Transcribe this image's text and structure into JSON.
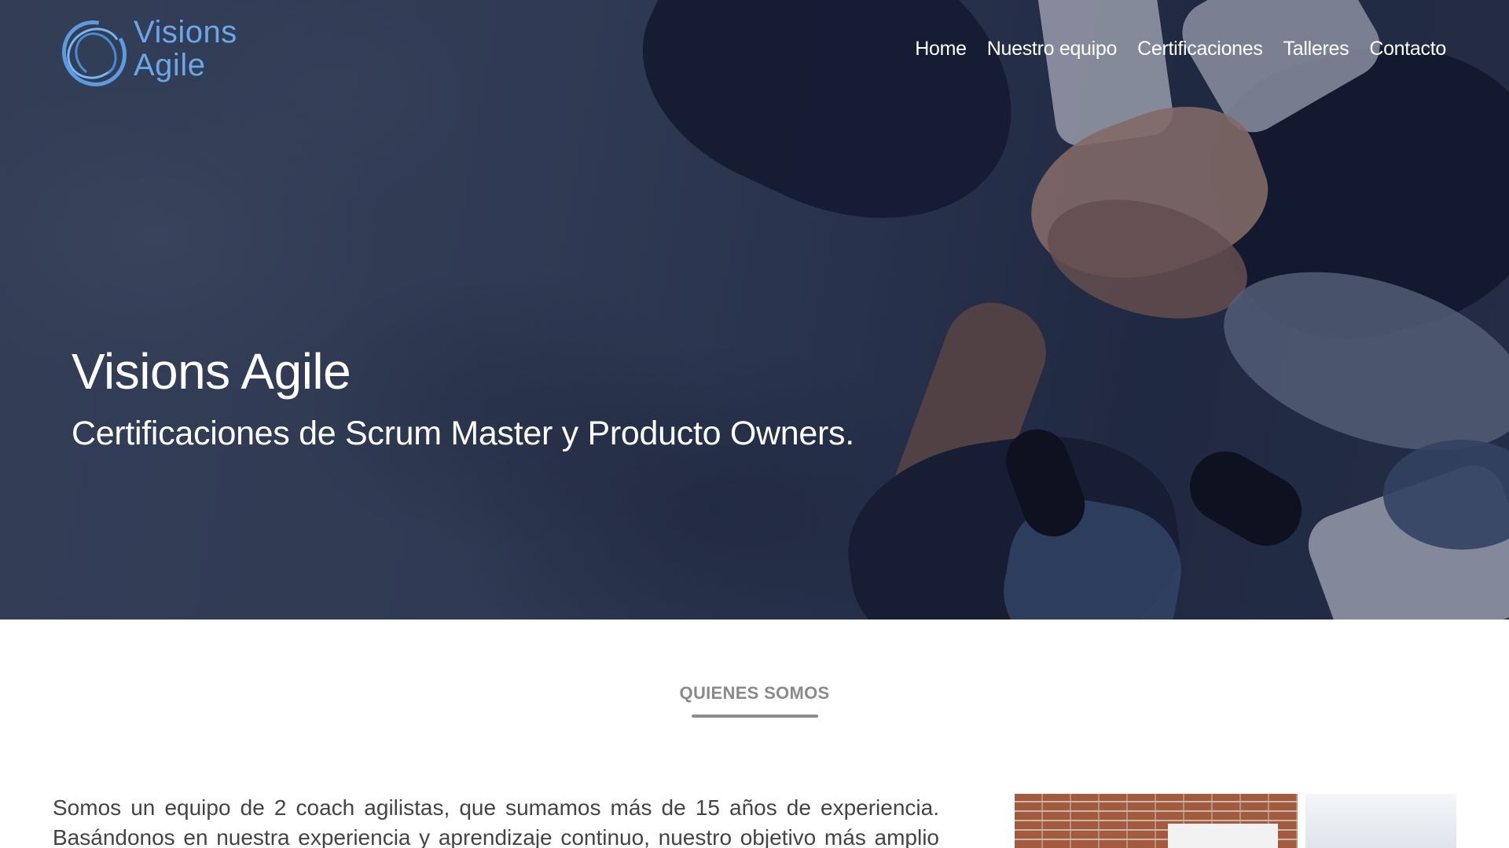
{
  "header": {
    "logo": {
      "line1": "Visions",
      "line2": "Agile"
    },
    "nav": [
      {
        "label": "Home"
      },
      {
        "label": "Nuestro equipo"
      },
      {
        "label": "Certificaciones"
      },
      {
        "label": "Talleres"
      },
      {
        "label": "Contacto"
      }
    ]
  },
  "hero": {
    "title": "Visions Agile",
    "subtitle": "Certificaciones de Scrum Master y Producto Owners."
  },
  "about": {
    "heading": "QUIENES SOMOS",
    "paragraph_line1": "Somos un equipo de 2 coach agilistas, que sumamos más de 15 años de experiencia.",
    "paragraph_line2": "Basándonos en nuestra experiencia y aprendizaje continuo, nuestro objetivo más amplio"
  },
  "colors": {
    "logo_blue": "#6aa6e8",
    "hero_overlay": "#1e2642",
    "heading_gray": "#8a8a8a",
    "body_text": "#444444"
  }
}
